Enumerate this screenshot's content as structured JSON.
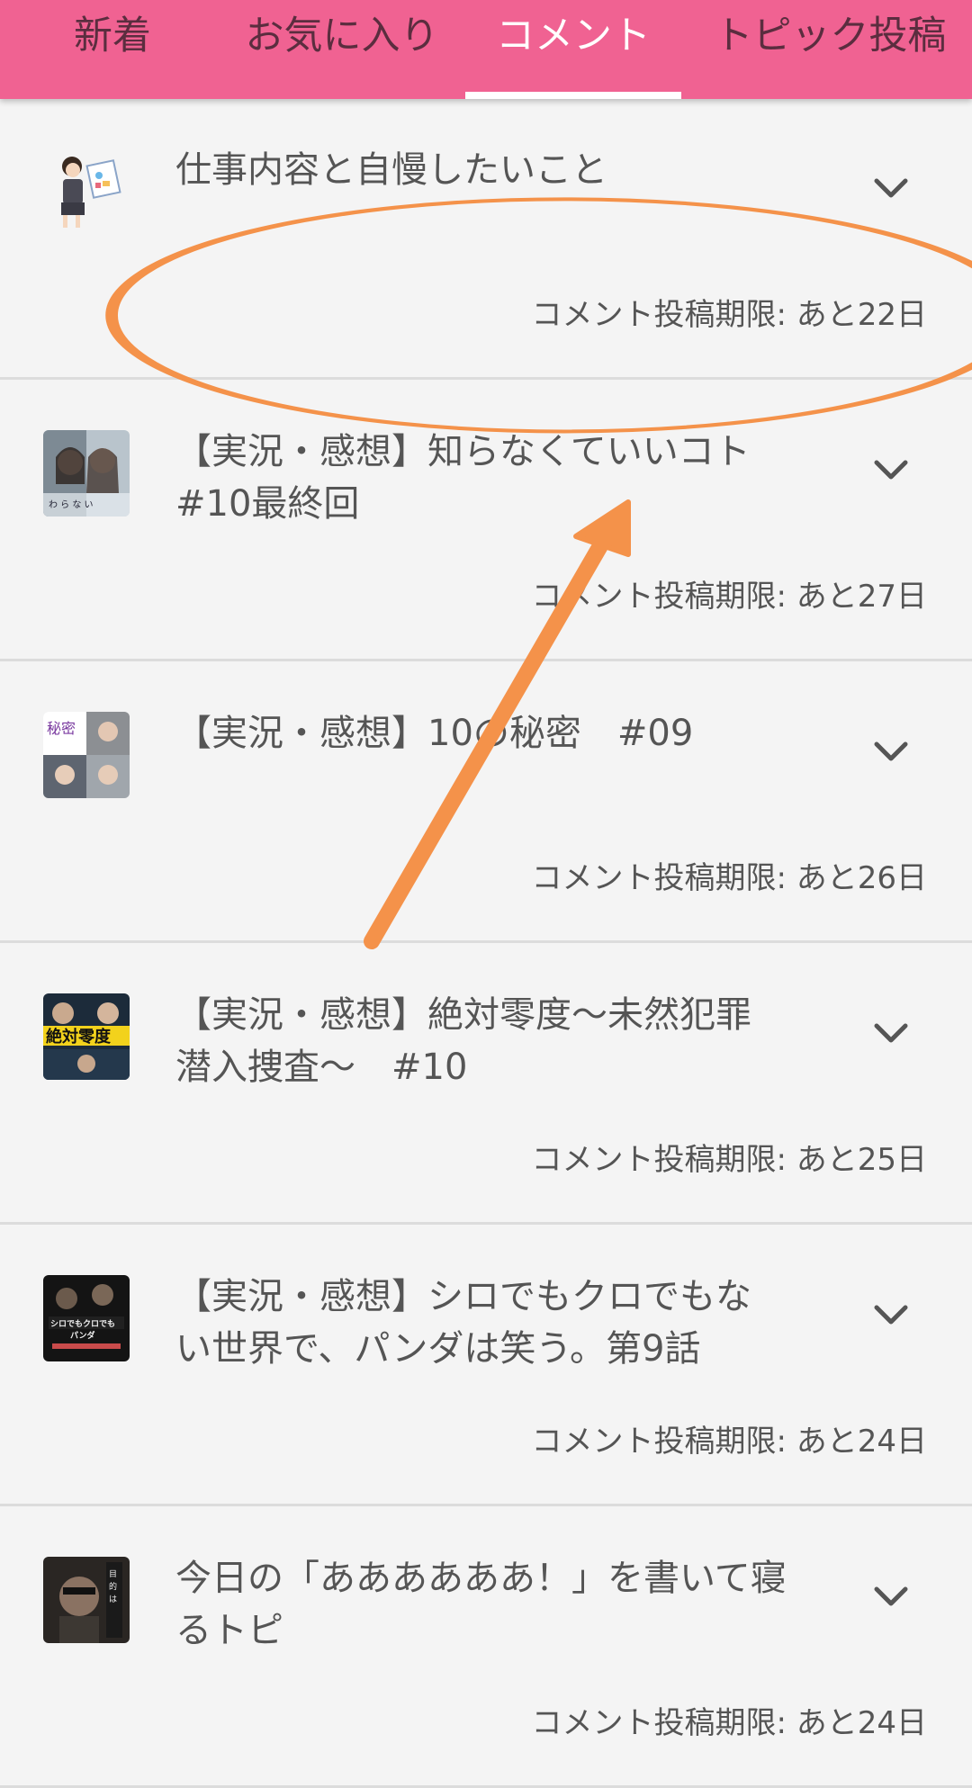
{
  "tabs": [
    {
      "label": "新着",
      "active": false
    },
    {
      "label": "お気に入り",
      "active": false
    },
    {
      "label": "コメント",
      "active": true
    },
    {
      "label": "トピック投稿",
      "active": false
    }
  ],
  "colors": {
    "header": "#f06292",
    "annotation": "#f4924a",
    "background": "#f4f4f4"
  },
  "topics": [
    {
      "title": "仕事内容と自慢したいこと",
      "deadline": "コメント投稿期限: あと22日",
      "thumbnail": "office-worker-illustration"
    },
    {
      "title": "【実況・感想】知らなくていいコト\n#10最終回",
      "deadline": "コメント投稿期限: あと27日",
      "thumbnail": "drama-poster"
    },
    {
      "title": "【実況・感想】10の秘密　#09",
      "deadline": "コメント投稿期限: あと26日",
      "thumbnail": "drama-poster"
    },
    {
      "title": "【実況・感想】絶対零度〜未然犯罪\n潜入捜査〜　#10",
      "deadline": "コメント投稿期限: あと25日",
      "thumbnail": "drama-poster"
    },
    {
      "title": "【実況・感想】シロでもクロでもな\nい世界で、パンダは笑う。第9話",
      "deadline": "コメント投稿期限: あと24日",
      "thumbnail": "drama-poster"
    },
    {
      "title": "今日の「ああああああ！」を書いて寝\nるトピ",
      "deadline": "コメント投稿期限: あと24日",
      "thumbnail": "drama-poster"
    }
  ],
  "annotations": {
    "shapes": [
      "orange-ellipse",
      "orange-arrow"
    ]
  }
}
